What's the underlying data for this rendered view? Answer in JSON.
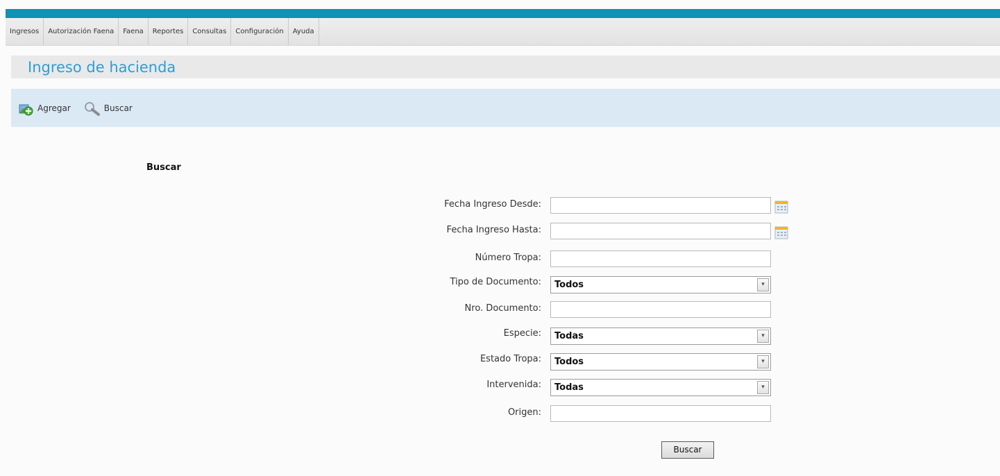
{
  "menu": [
    "Ingresos",
    "Autorización Faena",
    "Faena",
    "Reportes",
    "Consultas",
    "Configuración",
    "Ayuda"
  ],
  "page": {
    "title": "Ingreso de hacienda"
  },
  "toolbar": {
    "add_label": "Agregar",
    "search_label": "Buscar"
  },
  "search": {
    "title": "Buscar",
    "fields": {
      "fecha_desde": "Fecha Ingreso Desde:",
      "fecha_hasta": "Fecha Ingreso Hasta:",
      "numero_tropa": "Número Tropa:",
      "tipo_documento": "Tipo de Documento:",
      "nro_documento": "Nro. Documento:",
      "especie": "Especie:",
      "estado_tropa": "Estado Tropa:",
      "intervenida": "Intervenida:",
      "origen": "Origen:"
    },
    "values": {
      "tipo_documento": "Todos",
      "especie": "Todas",
      "estado_tropa": "Todos",
      "intervenida": "Todas"
    },
    "submit_label": "Buscar"
  },
  "colors": {
    "top_bar": "#0f92b6",
    "title": "#2a9fd8",
    "toolbar_bg": "#dbe9f5"
  }
}
